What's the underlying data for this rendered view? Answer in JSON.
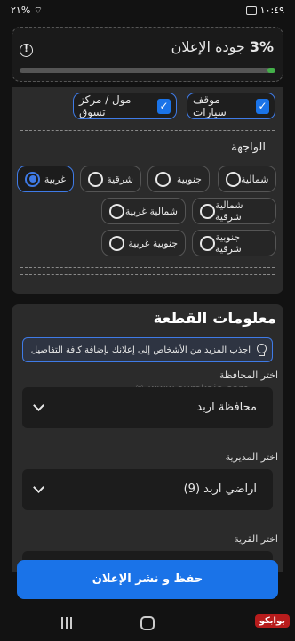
{
  "status_bar": {
    "time": "١٠:٤٩",
    "battery": "٢١%"
  },
  "quality": {
    "title": "جودة الإعلان",
    "percent": "3%",
    "progress": 0.03
  },
  "parking": {
    "options": [
      {
        "label": "موقف سيارات",
        "checked": true
      },
      {
        "label": "مول / مركز تسوق",
        "checked": true
      }
    ]
  },
  "facade": {
    "label": "الواجهة",
    "options": [
      {
        "label": "شمالية",
        "selected": false
      },
      {
        "label": "جنوبية",
        "selected": false
      },
      {
        "label": "شرقية",
        "selected": false
      },
      {
        "label": "غربية",
        "selected": true
      },
      {
        "label": "شمالية شرقية",
        "selected": false
      },
      {
        "label": "شمالية غربية",
        "selected": false
      },
      {
        "label": "جنوبية شرقية",
        "selected": false
      },
      {
        "label": "جنوبية غربية",
        "selected": false
      }
    ]
  },
  "plot_info": {
    "title": "معلومات القطعة",
    "tip": "اجذب المزيد من الأشخاص إلى إعلانك بإضافة كافة التفاصيل",
    "watermark": "© www.eurekajo.com",
    "governorate": {
      "label": "اختر المحافظة",
      "value": "محافظة اربد"
    },
    "directorate": {
      "label": "اختر المديرية",
      "value": "اراضي اربد (9)"
    },
    "village": {
      "label": "اختر القرية"
    }
  },
  "save_button": "حفظ و نشر الإعلان",
  "nav": {
    "logo": "بوابكو"
  },
  "colors": {
    "accent": "#1a73e8",
    "progress": "#43b049",
    "background": "#121212",
    "card": "#2b2b2b"
  }
}
